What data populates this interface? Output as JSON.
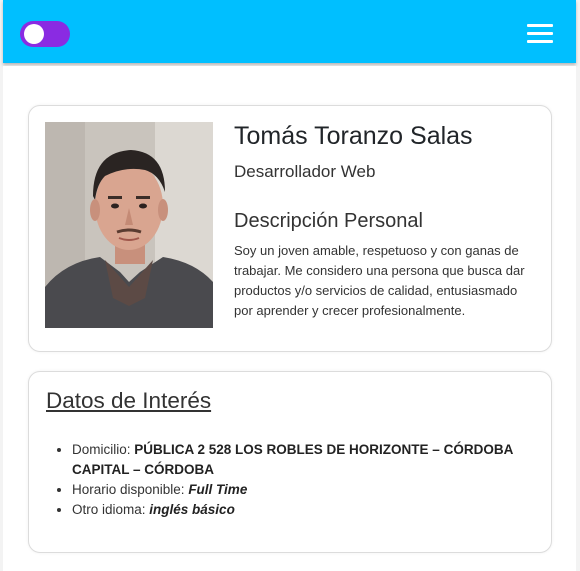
{
  "navbar": {
    "toggle_icon": "theme-toggle",
    "menu_icon": "hamburger-menu-icon",
    "background_color": "#00bfff",
    "toggle_color": "#8a2be2"
  },
  "profile": {
    "name": "Tomás Toranzo Salas",
    "role": "Desarrollador Web",
    "description_title": "Descripción Personal",
    "description": "Soy un joven amable, respetuoso y con ganas de trabajar. Me considero una persona que busca dar productos y/o servicios de calidad, entusiasmado por aprender y crecer profesionalmente."
  },
  "interest": {
    "title": "Datos de Interés",
    "items": [
      {
        "label": "Domicilio: ",
        "value": "PÚBLICA 2 528 LOS ROBLES DE HORIZONTE – CÓRDOBA CAPITAL – CÓRDOBA"
      },
      {
        "label": "Horario disponible: ",
        "value": "Full Time"
      },
      {
        "label": "Otro idioma: ",
        "value": "inglés básico"
      }
    ]
  }
}
